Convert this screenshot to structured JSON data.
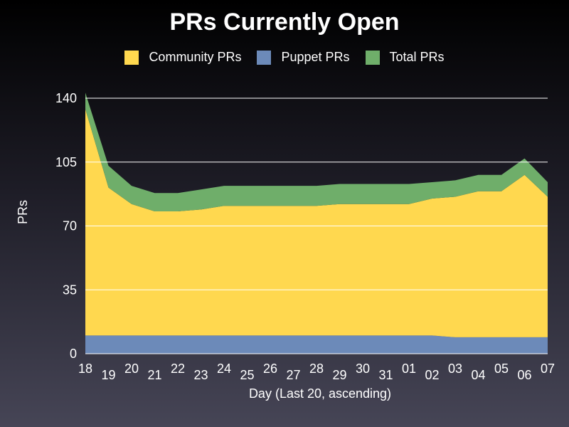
{
  "chart_data": {
    "type": "area",
    "stacked": true,
    "title": "PRs Currently Open",
    "xlabel": "Day (Last 20, ascending)",
    "ylabel": "PRs",
    "ylim": [
      0,
      140
    ],
    "yticks": [
      "0",
      "35",
      "70",
      "105",
      "140"
    ],
    "grid": "horizontal",
    "legend_position": "top",
    "categories": [
      "18",
      "19",
      "20",
      "21",
      "22",
      "23",
      "24",
      "25",
      "26",
      "27",
      "28",
      "29",
      "30",
      "31",
      "01",
      "02",
      "03",
      "04",
      "05",
      "06",
      "07"
    ],
    "series": [
      {
        "name": "Puppet PRs",
        "color": "#6c8ab9",
        "values": [
          10,
          10,
          10,
          10,
          10,
          10,
          10,
          10,
          10,
          10,
          10,
          10,
          10,
          10,
          10,
          10,
          9,
          9,
          9,
          9,
          9
        ]
      },
      {
        "name": "Community PRs",
        "color": "#ffd84f",
        "values": [
          124,
          81,
          72,
          68,
          68,
          69,
          71,
          71,
          71,
          71,
          71,
          72,
          72,
          72,
          72,
          75,
          77,
          80,
          80,
          89,
          77
        ]
      },
      {
        "name": "Total PRs",
        "color": "#6fae6a",
        "values": [
          9,
          12,
          10,
          10,
          10,
          11,
          11,
          11,
          11,
          11,
          11,
          11,
          11,
          11,
          11,
          9,
          9,
          9,
          9,
          9,
          8
        ]
      }
    ],
    "legend_order": [
      "Community PRs",
      "Puppet PRs",
      "Total PRs"
    ]
  }
}
